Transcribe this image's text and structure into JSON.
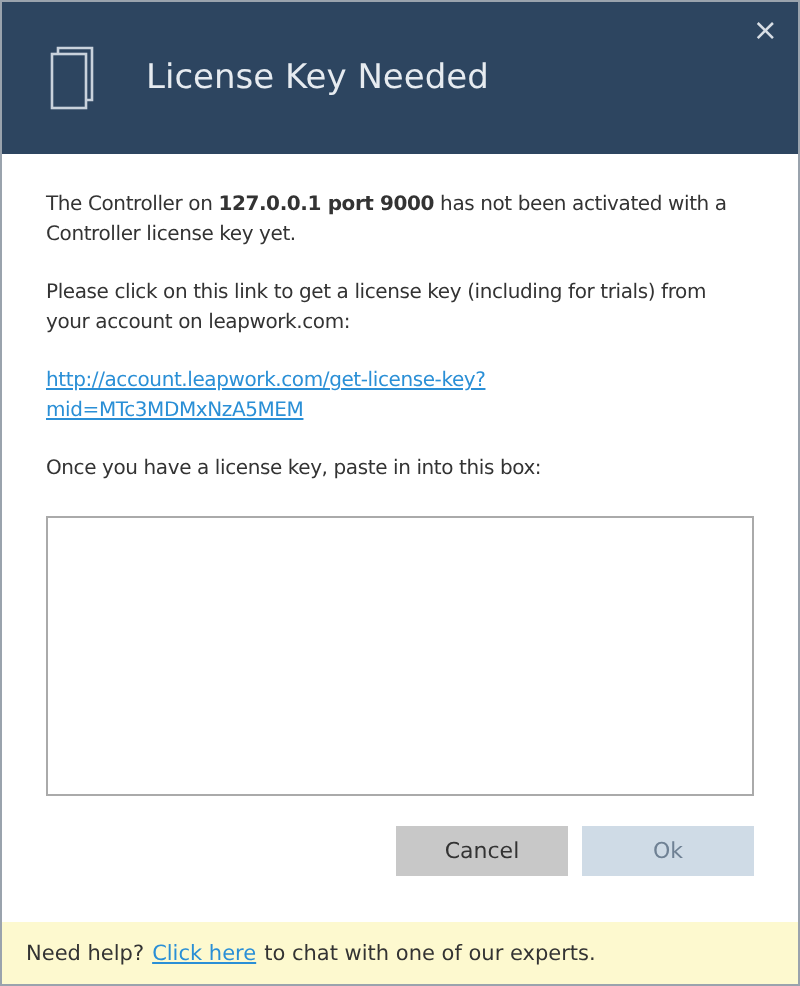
{
  "dialog": {
    "title": "License Key Needed",
    "close_label": "×"
  },
  "paragraphs": [
    "The Controller on **127.0.0.1 port 9000** has not been activated with a Controller license key yet.",
    "Please click on this link to get a license key (including for trials) from your account on leapwork.com:"
  ],
  "link": [
    "http://account.leapwork.com/get-license-key?",
    "mid=MTc3MDMxNzA5MEM"
  ],
  "prompt": "Once you have a license key, paste in into this box:",
  "buttons": [
    {
      "label": "Cancel",
      "disabled": false
    },
    {
      "label": "Ok",
      "disabled": true
    }
  ],
  "help": {
    "before": "Need help?",
    "link": "Click here",
    "after": "to chat with one of our experts."
  }
}
